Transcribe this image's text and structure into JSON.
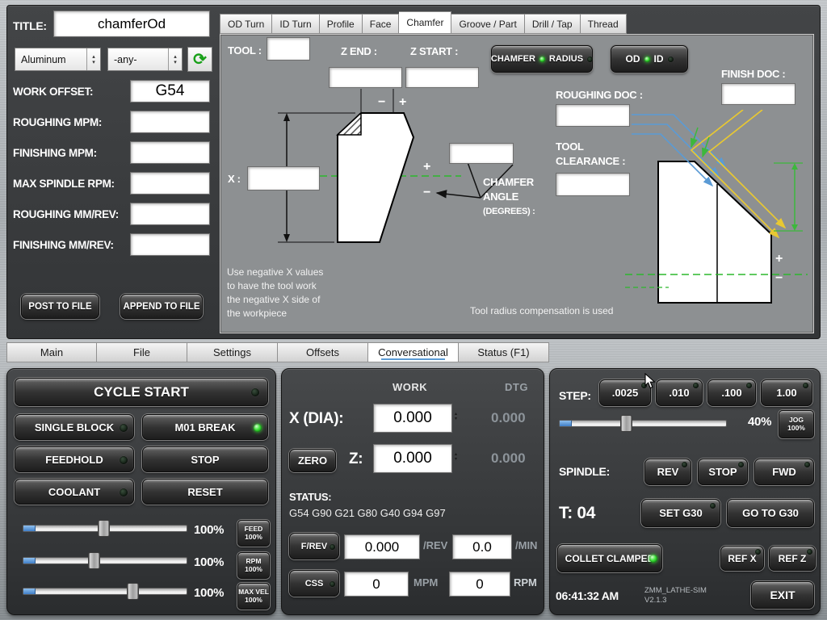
{
  "colors": {
    "led_green": "#3fe43a",
    "centerline_green": "#2db82d",
    "roughing_blue": "#5b9bd5",
    "finish_yellow": "#e8c832"
  },
  "icons": {
    "refresh": "⟳",
    "up_arrow": "▴",
    "down_arrow": "▾"
  },
  "left_form": {
    "title_label": "TITLE:",
    "title_value": "chamferOd",
    "material_value": "Aluminum",
    "filter_value": "-any-",
    "fields": [
      {
        "label": "WORK OFFSET:",
        "value": "G54"
      },
      {
        "label": "ROUGHING MPM:",
        "value": ""
      },
      {
        "label": "FINISHING MPM:",
        "value": ""
      },
      {
        "label": "MAX SPINDLE RPM:",
        "value": ""
      },
      {
        "label": "ROUGHING MM/REV:",
        "value": ""
      },
      {
        "label": "FINISHING MM/REV:",
        "value": ""
      }
    ],
    "post_to_file": "POST TO FILE",
    "append_to_file": "APPEND TO FILE"
  },
  "op_tabs": [
    {
      "label": "OD Turn"
    },
    {
      "label": "ID Turn"
    },
    {
      "label": "Profile"
    },
    {
      "label": "Face"
    },
    {
      "label": "Chamfer"
    },
    {
      "label": "Groove / Part"
    },
    {
      "label": "Drill / Tap"
    },
    {
      "label": "Thread"
    }
  ],
  "chamfer": {
    "tool_label": "TOOL :",
    "tool_value": "",
    "z_end_label": "Z END :",
    "z_end_value": "",
    "z_start_label": "Z START :",
    "z_start_value": "",
    "chamfer_toggle": "CHAMFER",
    "radius_toggle": "RADIUS",
    "od_toggle": "OD",
    "id_toggle": "ID",
    "finish_doc_label": "FINISH DOC :",
    "finish_doc_value": "",
    "roughing_doc_label": "ROUGHING DOC :",
    "roughing_doc_value": "",
    "tool_clearance_label_1": "TOOL",
    "tool_clearance_label_2": "CLEARANCE :",
    "tool_clearance_value": "",
    "x_label": "X :",
    "x_value": "",
    "angle_value": "",
    "angle_label_1": "CHAMFER",
    "angle_label_2": "ANGLE",
    "angle_label_3": "(DEGREES) :",
    "plus": "+",
    "minus": "−",
    "note_line_1": "Use negative X values",
    "note_line_2": "to have the tool work",
    "note_line_3": "the negative X side of",
    "note_line_4": "the workpiece",
    "comp_note": "Tool radius compensation is used"
  },
  "main_tabs": [
    {
      "label": "Main"
    },
    {
      "label": "File"
    },
    {
      "label": "Settings"
    },
    {
      "label": "Offsets"
    },
    {
      "label": "Conversational"
    },
    {
      "label": "Status (F1)"
    }
  ],
  "controls": {
    "cycle_start": "CYCLE START",
    "single_block": "SINGLE BLOCK",
    "m01_break": "M01 BREAK",
    "feedhold": "FEEDHOLD",
    "stop": "STOP",
    "coolant": "COOLANT",
    "reset": "RESET",
    "sliders": [
      {
        "percent": "100%",
        "btn_line_1": "FEED",
        "btn_line_2": "100%"
      },
      {
        "percent": "100%",
        "btn_line_1": "RPM",
        "btn_line_2": "100%"
      },
      {
        "percent": "100%",
        "btn_line_1": "MAX VEL",
        "btn_line_2": "100%"
      }
    ]
  },
  "dro": {
    "work_header": "WORK",
    "dtg_header": "DTG",
    "x_label": "X (DIA):",
    "x_value": "0.000",
    "x_dtg": "0.000",
    "zero_btn": "ZERO",
    "z_label": "Z:",
    "z_value": "0.000",
    "z_dtg": "0.000",
    "status_label": "STATUS:",
    "status_value": "G54 G90 G21 G80 G40 G94 G97",
    "frev_btn": "F/REV",
    "frev_value": "0.000",
    "rev_unit": "/REV",
    "fmin_value": "0.0",
    "min_unit": "/MIN",
    "css_btn": "CSS",
    "css_value": "0",
    "mpm_unit": "MPM",
    "rpm_value": "0",
    "rpm_unit": "RPM"
  },
  "jog": {
    "step_label": "STEP:",
    "steps": [
      {
        "label": ".0025"
      },
      {
        "label": ".010"
      },
      {
        "label": ".100"
      },
      {
        "label": "1.00"
      }
    ],
    "jog_percent": "40%",
    "jog_btn_line_1": "JOG",
    "jog_btn_line_2": "100%",
    "spindle_label": "SPINDLE:",
    "rev": "REV",
    "stop": "STOP",
    "fwd": "FWD",
    "tool_readout": "T: 04",
    "set_g30": "SET G30",
    "goto_g30": "GO TO G30",
    "collet": "COLLET CLAMPED",
    "ref_x": "REF X",
    "ref_z": "REF Z",
    "time": "06:41:32 AM",
    "app_name": "ZMM_LATHE-SIM",
    "app_version": "V2.1.3",
    "exit": "EXIT"
  }
}
